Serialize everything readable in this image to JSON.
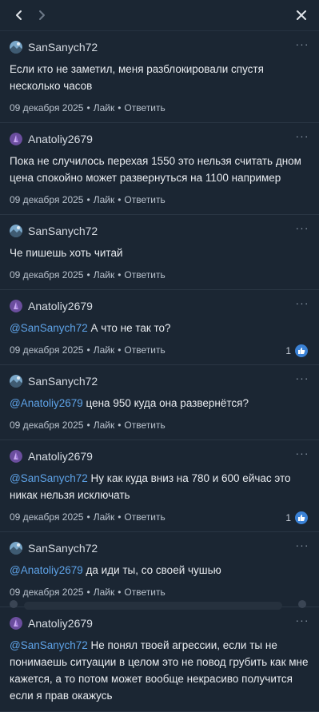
{
  "nav": {
    "back_icon": "chevron-left-icon",
    "forward_icon": "chevron-right-icon",
    "close_icon": "close-icon"
  },
  "actions": {
    "like": "Лайк",
    "reply": "Ответить",
    "separator": "•"
  },
  "comments": [
    {
      "author": "SanSanych72",
      "avatar": "sansanych",
      "mention": "",
      "text": "Если кто не заметил, меня разблокировали спустя несколько часов",
      "date": "09 декабря 2025",
      "likes": ""
    },
    {
      "author": "Anatoliy2679",
      "avatar": "anatoliy",
      "mention": "",
      "text": "Пока не случилось перехая 1550 это нельзя считать дном цена спокойно может развернуться на 1100 например",
      "date": "09 декабря 2025",
      "likes": ""
    },
    {
      "author": "SanSanych72",
      "avatar": "sansanych",
      "mention": "",
      "text": "Че пишешь хоть читай",
      "date": "09 декабря 2025",
      "likes": ""
    },
    {
      "author": "Anatoliy2679",
      "avatar": "anatoliy",
      "mention": "@SanSanych72",
      "text": " А что не так то?",
      "date": "09 декабря 2025",
      "likes": "1"
    },
    {
      "author": "SanSanych72",
      "avatar": "sansanych",
      "mention": "@Anatoliy2679",
      "text": " цена 950 куда она развернётся?",
      "date": "09 декабря 2025",
      "likes": ""
    },
    {
      "author": "Anatoliy2679",
      "avatar": "anatoliy",
      "mention": "@SanSanych72",
      "text": " Ну как куда вниз на 780 и 600 ейчас это никак нельзя исключать",
      "date": "09 декабря 2025",
      "likes": "1"
    },
    {
      "author": "SanSanych72",
      "avatar": "sansanych",
      "mention": "@Anatoliy2679",
      "text": " да иди ты, со своей чушью",
      "date": "09 декабря 2025",
      "likes": ""
    },
    {
      "author": "Anatoliy2679",
      "avatar": "anatoliy",
      "mention": "@SanSanych72",
      "text": " Не понял твоей агрессии, если ты не понимаешь ситуации в целом это не повод грубить как мне кажется, а то потом может вообще некрасиво получится если я прав окажусь",
      "date": "",
      "likes": ""
    }
  ]
}
